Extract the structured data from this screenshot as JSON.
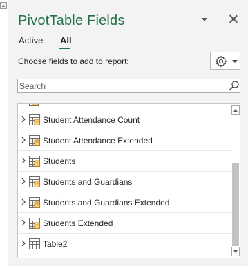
{
  "pane": {
    "title": "PivotTable Fields",
    "tabs": [
      {
        "label": "Active",
        "selected": false
      },
      {
        "label": "All",
        "selected": true
      }
    ],
    "instruction": "Choose fields to add to report:",
    "settings_icon": "gear-icon",
    "accent_color": "#217346"
  },
  "search": {
    "placeholder": "Search",
    "value": "",
    "icon": "search-icon"
  },
  "fields": [
    {
      "label": "Student Attendance Count",
      "icon": "olap-table-icon"
    },
    {
      "label": "Student Attendance Extended",
      "icon": "olap-table-icon"
    },
    {
      "label": "Students",
      "icon": "olap-table-icon"
    },
    {
      "label": "Students and Guardians",
      "icon": "olap-table-icon"
    },
    {
      "label": "Students and Guardians Extended",
      "icon": "olap-table-icon"
    },
    {
      "label": "Students Extended",
      "icon": "olap-table-icon"
    },
    {
      "label": "Table2",
      "icon": "table-icon"
    }
  ]
}
